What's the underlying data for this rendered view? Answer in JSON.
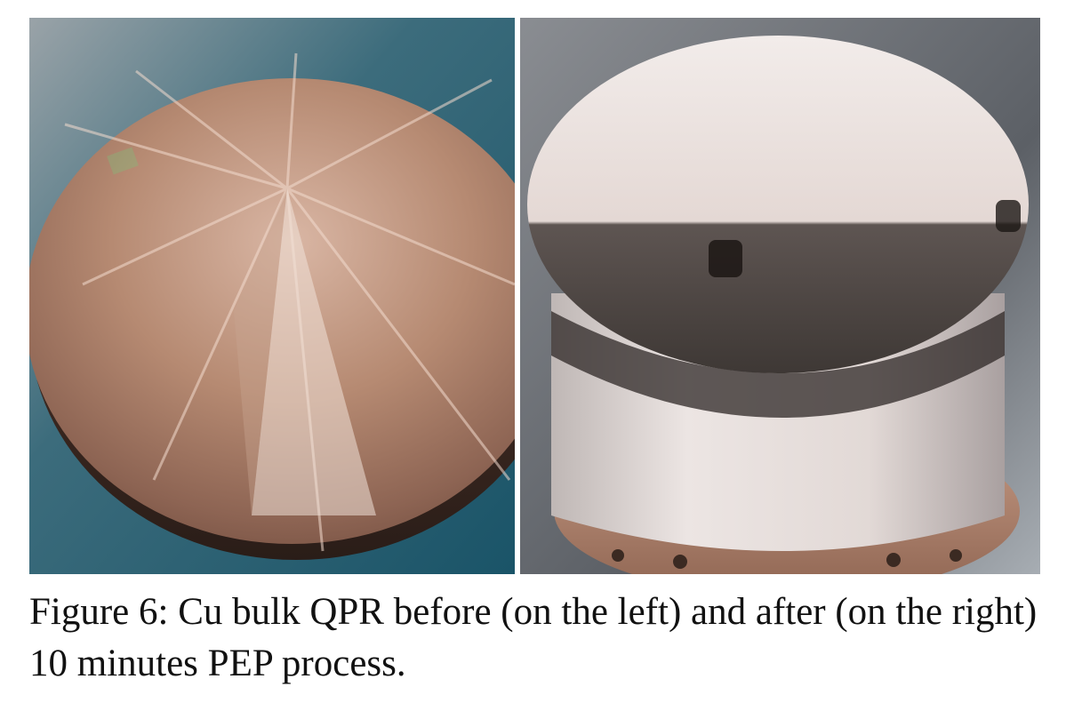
{
  "figure": {
    "caption": "Figure 6: Cu bulk QPR before (on the left) and after (on the right) 10 minutes PEP process."
  },
  "colors": {
    "copper": "#b68a72",
    "copper_light": "#e6cbbd",
    "polished_white": "#ece4e0",
    "background_blue": "#1e5a6e",
    "caption_text": "#111111"
  }
}
